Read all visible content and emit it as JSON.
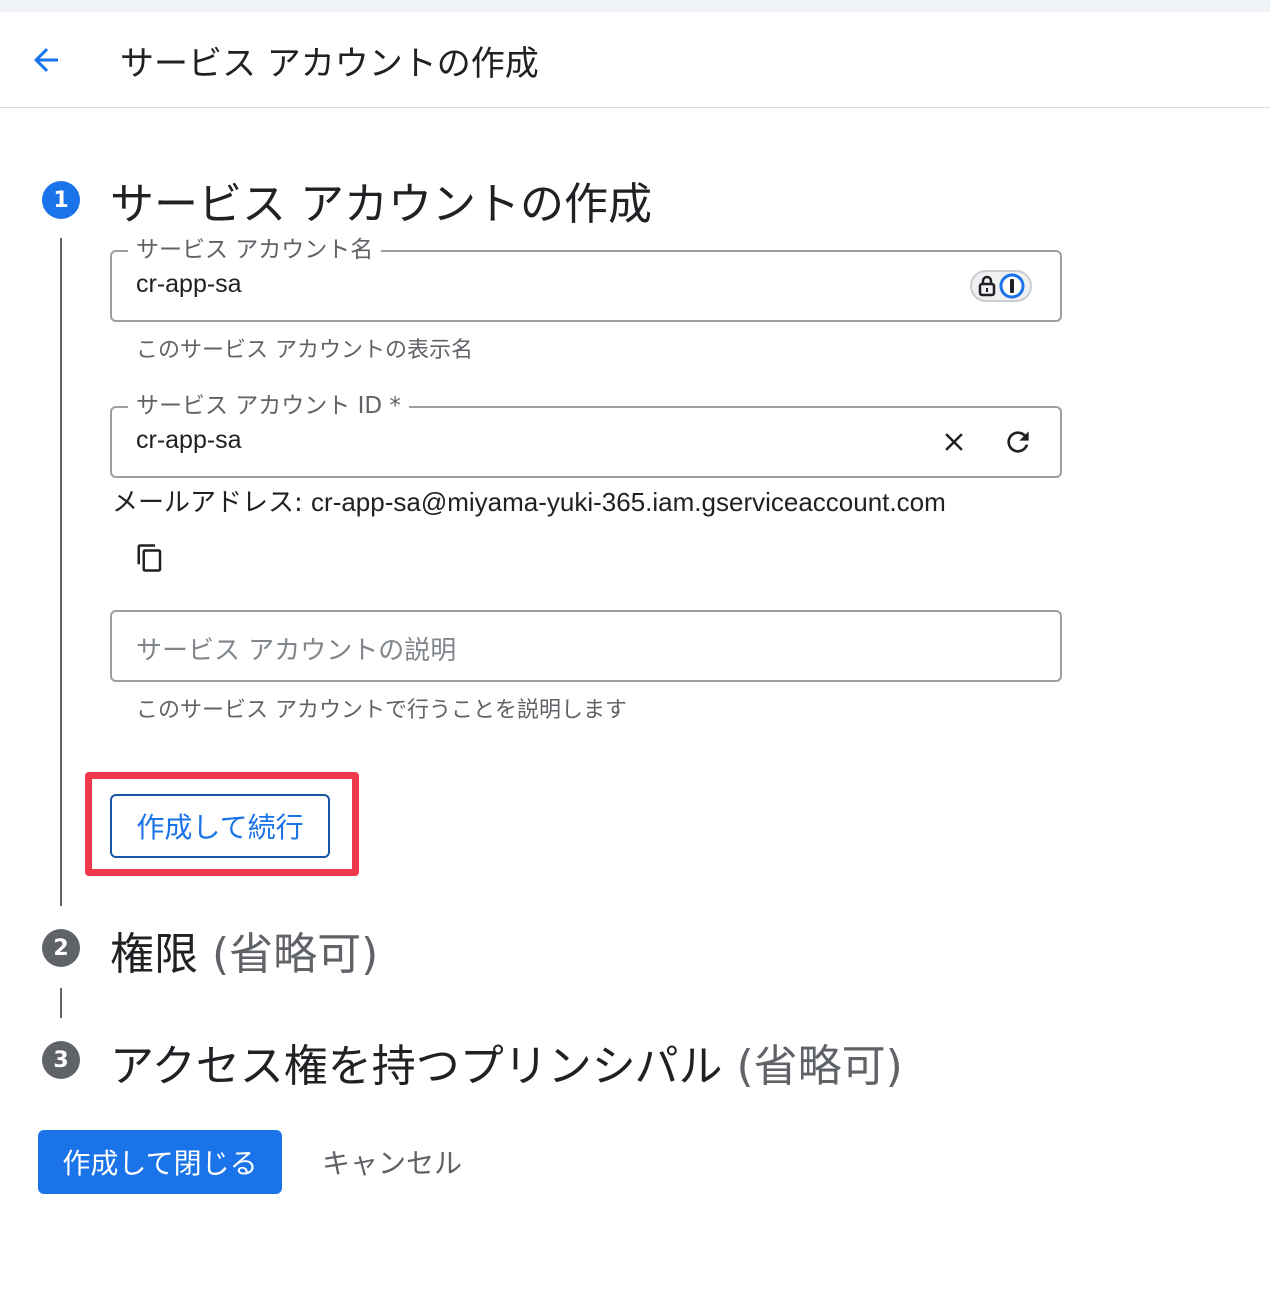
{
  "header": {
    "title": "サービス アカウントの作成"
  },
  "steps": [
    {
      "number": "1",
      "title": "サービス アカウントの作成",
      "optional": ""
    },
    {
      "number": "2",
      "title": "権限",
      "optional": "(省略可)"
    },
    {
      "number": "3",
      "title": "アクセス権を持つプリンシパル",
      "optional": "(省略可)"
    }
  ],
  "form": {
    "name_field": {
      "label": "サービス アカウント名",
      "value": "cr-app-sa",
      "helper": "このサービス アカウントの表示名"
    },
    "id_field": {
      "label": "サービス アカウント ID *",
      "value": "cr-app-sa"
    },
    "email": {
      "label": "メールアドレス: ",
      "value": "cr-app-sa@miyama-yuki-365.iam.gserviceaccount.com"
    },
    "description_field": {
      "placeholder": "サービス アカウントの説明",
      "helper": "このサービス アカウントで行うことを説明します"
    }
  },
  "buttons": {
    "create_continue": "作成して続行",
    "create_close": "作成して閉じる",
    "cancel": "キャンセル"
  },
  "colors": {
    "primary": "#1a73e8",
    "highlight": "#f0384a",
    "step_inactive": "#5f6368"
  }
}
